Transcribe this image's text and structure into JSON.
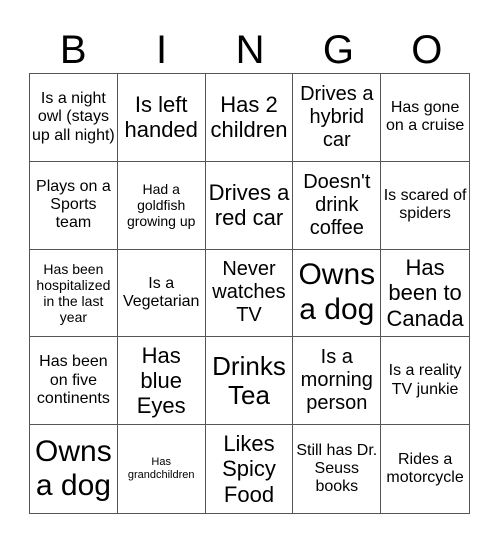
{
  "header": [
    "B",
    "I",
    "N",
    "G",
    "O"
  ],
  "cells": [
    "Is a night owl (stays up all night)",
    "Is left handed",
    "Has 2 children",
    "Drives a hybrid car",
    "Has gone on a cruise",
    "Plays on a Sports team",
    "Had a goldfish growing up",
    "Drives a red car",
    "Doesn't drink coffee",
    "Is scared of spiders",
    "Has been hospitalized in the last year",
    "Is a Vegetarian",
    "Never watches TV",
    "Owns a dog",
    "Has been to Canada",
    "Has been on five continents",
    "Has blue Eyes",
    "Drinks Tea",
    "Is a morning person",
    "Is a reality TV junkie",
    "Owns a dog",
    "Has grandchildren",
    "Likes Spicy Food",
    "Still has Dr. Seuss books",
    "Rides a motorcycle"
  ]
}
